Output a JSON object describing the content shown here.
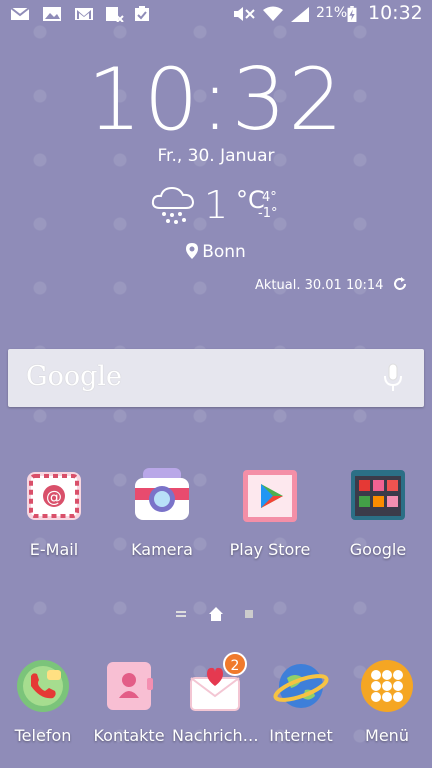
{
  "status_bar": {
    "battery": "21%",
    "time": "10:32",
    "icons": [
      "email-icon",
      "gallery-icon",
      "gmail-icon",
      "storage-icon",
      "clipboard-check-icon",
      "mute-icon",
      "wifi-icon",
      "signal-icon",
      "battery-charging-icon"
    ]
  },
  "clock": {
    "time": "10:32",
    "date": "Fr., 30. Januar"
  },
  "weather": {
    "icon": "snow-cloud-icon",
    "temperature": "1",
    "unit": "°C",
    "high": "4°",
    "low": "-1°",
    "location": "Bonn",
    "updated": "Aktual. 30.01 10:14"
  },
  "search": {
    "logo_text": "Google",
    "mic_icon": "microphone-icon"
  },
  "apps": [
    {
      "label": "E-Mail",
      "icon": "email-app-icon"
    },
    {
      "label": "Kamera",
      "icon": "camera-app-icon"
    },
    {
      "label": "Play Store",
      "icon": "play-store-icon"
    },
    {
      "label": "Google",
      "icon": "google-folder-icon"
    }
  ],
  "pager": {
    "pages": 3,
    "current": 2
  },
  "dock": [
    {
      "label": "Telefon",
      "icon": "phone-icon"
    },
    {
      "label": "Kontakte",
      "icon": "contacts-icon"
    },
    {
      "label": "Nachrich…",
      "icon": "messages-icon",
      "badge": "2"
    },
    {
      "label": "Internet",
      "icon": "internet-globe-icon"
    },
    {
      "label": "Menü",
      "icon": "apps-menu-icon"
    }
  ],
  "colors": {
    "wallpaper": "#8f8cb8",
    "badge": "#f07a2c",
    "search_bar": "#e6e6ee"
  }
}
